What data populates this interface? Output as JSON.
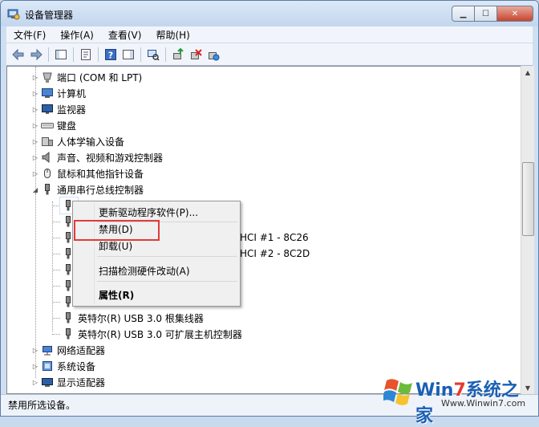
{
  "window": {
    "title": "设备管理器",
    "min_glyph": "▁",
    "max_glyph": "☐",
    "close_glyph": "✕"
  },
  "menu": [
    "文件(F)",
    "操作(A)",
    "查看(V)",
    "帮助(H)"
  ],
  "tree": {
    "expand_glyph": "▷",
    "collapse_glyph": "◢",
    "items": [
      {
        "label": "端口 (COM 和 LPT)",
        "icon": "port-icon"
      },
      {
        "label": "计算机",
        "icon": "computer-icon"
      },
      {
        "label": "监视器",
        "icon": "monitor-icon"
      },
      {
        "label": "键盘",
        "icon": "keyboard-icon"
      },
      {
        "label": "人体学输入设备",
        "icon": "hid-icon"
      },
      {
        "label": "声音、视频和游戏控制器",
        "icon": "speaker-icon"
      },
      {
        "label": "鼠标和其他指针设备",
        "icon": "mouse-icon"
      },
      {
        "label": "通用串行总线控制器",
        "icon": "usb-icon"
      }
    ],
    "usb_children": [
      {
        "label": ""
      },
      {
        "label": ""
      },
      {
        "label": "HCI #1 - 8C26"
      },
      {
        "label": "HCI #2 - 8C2D"
      },
      {
        "label": ""
      },
      {
        "label": ""
      },
      {
        "label": ""
      },
      {
        "label": "英特尔(R) USB 3.0 根集线器"
      },
      {
        "label": "英特尔(R) USB 3.0 可扩展主机控制器"
      }
    ],
    "after_items": [
      {
        "label": "网络适配器",
        "icon": "network-icon"
      },
      {
        "label": "系统设备",
        "icon": "system-icon"
      },
      {
        "label": "显示适配器",
        "icon": "display-adapter-icon"
      }
    ]
  },
  "context_menu": {
    "update_driver": "更新驱动程序软件(P)...",
    "disable": "禁用(D)",
    "uninstall": "卸载(U)",
    "scan": "扫描检测硬件改动(A)",
    "properties": "属性(R)"
  },
  "status": {
    "text": "禁用所选设备。"
  },
  "watermark": {
    "brand_prefix": "Win",
    "brand_digit": "7",
    "brand_suffix": "系统之家",
    "url": "Www.Winwin7.com"
  },
  "colors": {
    "highlight_border": "#e23a3a",
    "title_bg": "#c9d9ee"
  }
}
